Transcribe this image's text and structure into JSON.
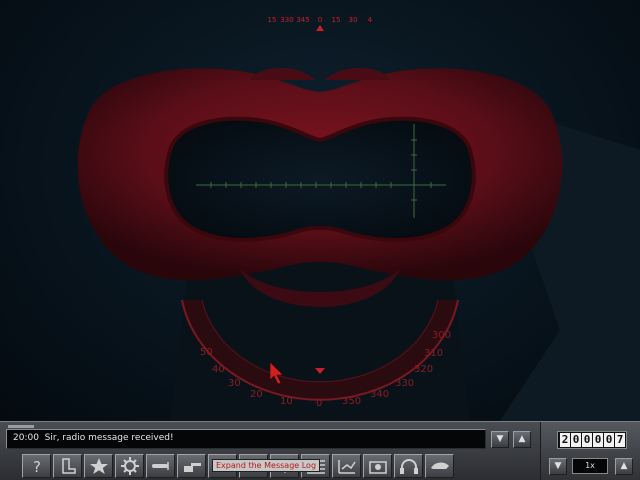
{
  "compass": {
    "labels": [
      "15",
      "330",
      "345",
      "0",
      "15",
      "30",
      "4"
    ]
  },
  "dial": {
    "labels": [
      "50",
      "40",
      "30",
      "20",
      "10",
      "0",
      "350",
      "340",
      "330",
      "320",
      "310",
      "300"
    ]
  },
  "message_log": {
    "time": "20:00",
    "message": "Sir, radio message received!",
    "scroll_down_icon": "triangle-down-icon",
    "scroll_up_icon": "triangle-up-icon"
  },
  "toolbar": {
    "tools": [
      "help-icon",
      "periscope-icon",
      "star-icon",
      "gear-icon",
      "torpedo-icon",
      "deck-gun-icon",
      "binoculars-icon",
      "ship-icon",
      "list-icon",
      "chart-icon",
      "radio-icon",
      "headphones-icon",
      "officer-cap-icon"
    ],
    "tooltip": "Expand the Message Log"
  },
  "time_panel": {
    "digits": [
      "2",
      "0",
      "0",
      "0",
      "0",
      "7"
    ],
    "time_compression": "1x"
  },
  "colors": {
    "accent_red": "#c8202a",
    "crosshair_green": "#3c6b3a"
  }
}
